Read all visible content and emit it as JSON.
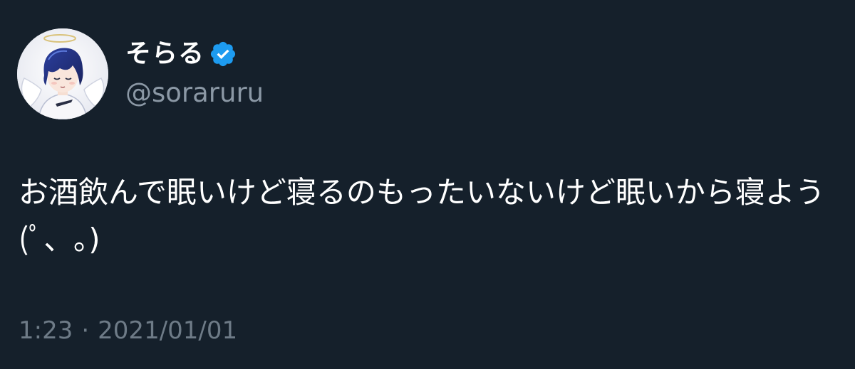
{
  "user": {
    "display_name": "そらる",
    "handle": "@soraruru",
    "verified_icon": "verified-badge-icon",
    "avatar_icon": "user-avatar-illustration"
  },
  "tweet": {
    "text": "お酒飲んで眠いけど寝るのもったいないけど眠いから寝よう(ﾟ、｡)",
    "time": "1:23",
    "separator": "·",
    "date": "2021/01/01"
  },
  "colors": {
    "background": "#15202b",
    "primary_text": "#ffffff",
    "secondary_text": "#8b98a5",
    "verified_blue": "#1d9bf0"
  }
}
